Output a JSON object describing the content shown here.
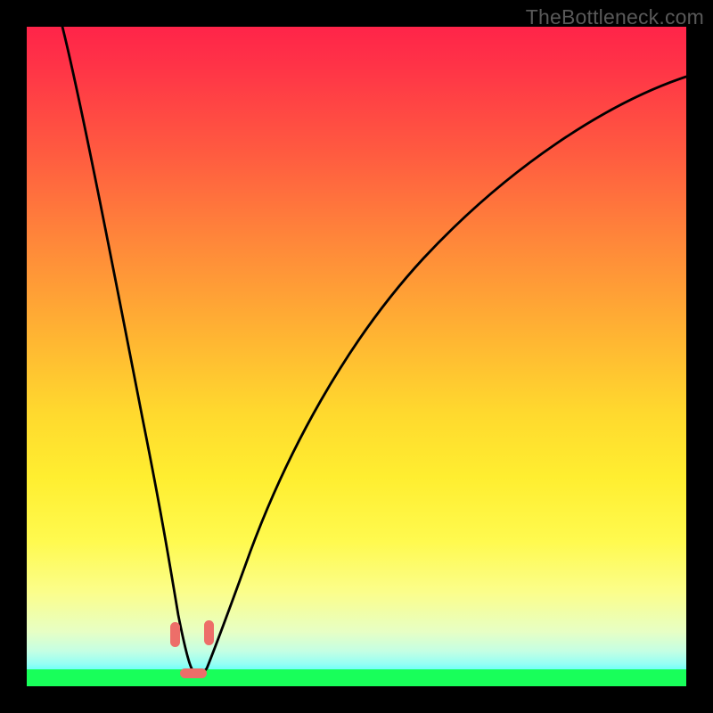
{
  "watermark": "TheBottleneck.com",
  "chart_data": {
    "type": "line",
    "title": "",
    "xlabel": "",
    "ylabel": "",
    "xlim": [
      0,
      100
    ],
    "ylim": [
      0,
      100
    ],
    "grid": false,
    "series": [
      {
        "name": "bottleneck-curve",
        "x": [
          1,
          3,
          5,
          7,
          9,
          11,
          13,
          15,
          17,
          19,
          21,
          22,
          23,
          24,
          25,
          26,
          27,
          28,
          30,
          33,
          36,
          40,
          45,
          50,
          55,
          60,
          66,
          72,
          78,
          84,
          90,
          95,
          100
        ],
        "y": [
          100,
          93,
          86,
          79,
          72,
          65,
          58,
          50,
          42,
          33,
          24,
          18,
          12,
          6,
          2,
          0,
          0,
          2,
          6,
          12,
          18,
          25,
          33,
          40,
          47,
          53,
          60,
          66,
          72,
          77,
          82,
          86,
          89
        ]
      }
    ],
    "minimum_region_x": [
      23,
      27
    ],
    "markers": [
      {
        "name": "marker-left",
        "percentile_x": 22.2,
        "percentile_y": 5.2
      },
      {
        "name": "marker-right",
        "percentile_x": 27.4,
        "percentile_y": 5.0
      },
      {
        "name": "marker-bottom",
        "percentile_x": 25.0,
        "percentile_y": 0.5
      }
    ],
    "marker_color": "#ed6e69",
    "curve_color": "#000000",
    "gradient_stops": [
      {
        "pct": 0,
        "color": "#ff2449"
      },
      {
        "pct": 20,
        "color": "#ff5c40"
      },
      {
        "pct": 47,
        "color": "#ffb133"
      },
      {
        "pct": 70,
        "color": "#ffee30"
      },
      {
        "pct": 88,
        "color": "#fbfe8c"
      },
      {
        "pct": 97,
        "color": "#c5ffe3"
      },
      {
        "pct": 100,
        "color": "#6cfff9"
      }
    ],
    "green_strip_color": "#18ff5a"
  }
}
